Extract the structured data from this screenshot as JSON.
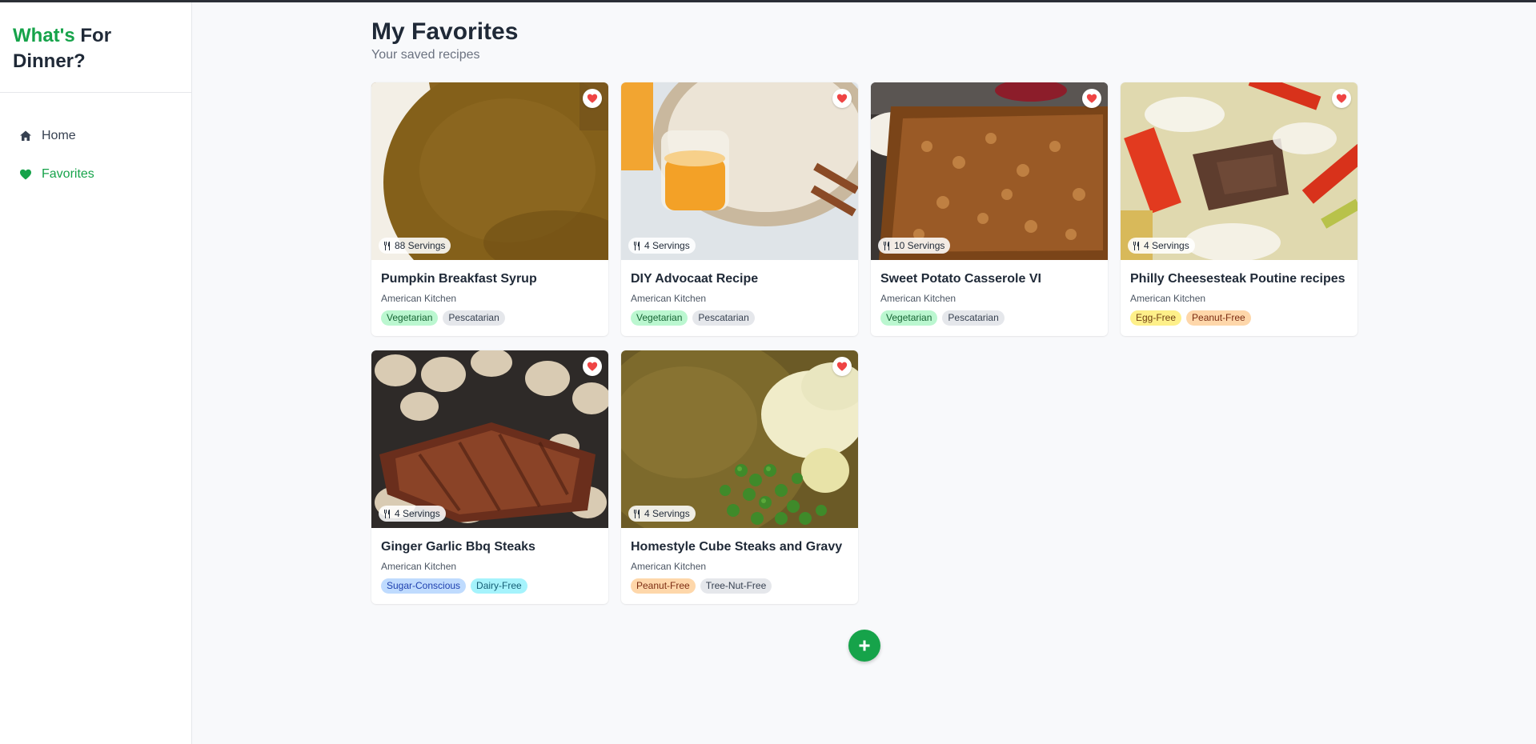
{
  "brand": {
    "part1": "What's",
    "part2": "For Dinner?",
    "accent_color": "#16a34a"
  },
  "nav": [
    {
      "label": "Home",
      "icon": "home-icon"
    },
    {
      "label": "Favorites",
      "icon": "heart-icon",
      "active": true
    }
  ],
  "page": {
    "title": "My Favorites",
    "subtitle": "Your saved recipes"
  },
  "recipes": [
    {
      "name": "Pumpkin Breakfast Syrup",
      "cuisine": "American Kitchen",
      "servings": "88 Servings",
      "tags": [
        {
          "label": "Vegetarian",
          "color": "green"
        },
        {
          "label": "Pescatarian",
          "color": "gray"
        }
      ]
    },
    {
      "name": "DIY Advocaat Recipe",
      "cuisine": "American Kitchen",
      "servings": "4 Servings",
      "tags": [
        {
          "label": "Vegetarian",
          "color": "green"
        },
        {
          "label": "Pescatarian",
          "color": "gray"
        }
      ]
    },
    {
      "name": "Sweet Potato Casserole VI",
      "cuisine": "American Kitchen",
      "servings": "10 Servings",
      "tags": [
        {
          "label": "Vegetarian",
          "color": "green"
        },
        {
          "label": "Pescatarian",
          "color": "gray"
        }
      ]
    },
    {
      "name": "Philly Cheesesteak Poutine recipes",
      "cuisine": "American Kitchen",
      "servings": "4 Servings",
      "tags": [
        {
          "label": "Egg-Free",
          "color": "yellow"
        },
        {
          "label": "Peanut-Free",
          "color": "orange"
        }
      ]
    },
    {
      "name": "Ginger Garlic Bbq Steaks",
      "cuisine": "American Kitchen",
      "servings": "4 Servings",
      "tags": [
        {
          "label": "Sugar-Conscious",
          "color": "blue"
        },
        {
          "label": "Dairy-Free",
          "color": "cyan"
        }
      ]
    },
    {
      "name": "Homestyle Cube Steaks and Gravy",
      "cuisine": "American Kitchen",
      "servings": "4 Servings",
      "tags": [
        {
          "label": "Peanut-Free",
          "color": "orange"
        },
        {
          "label": "Tree-Nut-Free",
          "color": "gray"
        }
      ]
    }
  ],
  "icons": {
    "favorite": "heart-icon",
    "servings": "utensils-icon",
    "add": "plus-icon"
  }
}
